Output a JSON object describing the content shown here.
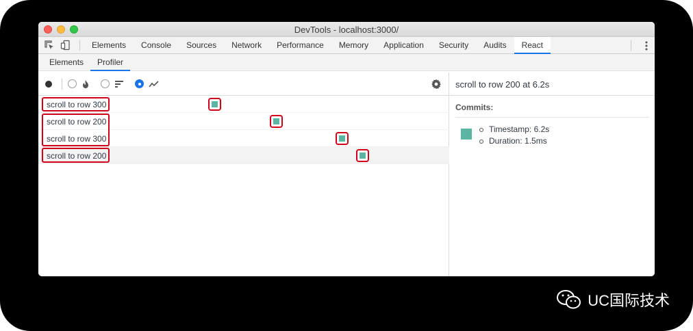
{
  "window": {
    "title": "DevTools - localhost:3000/"
  },
  "main_tabs": [
    {
      "label": "Elements"
    },
    {
      "label": "Console"
    },
    {
      "label": "Sources"
    },
    {
      "label": "Network"
    },
    {
      "label": "Performance"
    },
    {
      "label": "Memory"
    },
    {
      "label": "Application"
    },
    {
      "label": "Security"
    },
    {
      "label": "Audits"
    },
    {
      "label": "React",
      "active": true
    }
  ],
  "sub_tabs": [
    {
      "label": "Elements"
    },
    {
      "label": "Profiler",
      "active": true
    }
  ],
  "interactions": [
    {
      "label": "scroll to row 300",
      "commit_time": 0.42
    },
    {
      "label": "scroll to row 200",
      "commit_time": 0.57
    },
    {
      "label": "scroll to row 300",
      "commit_time": 0.73
    },
    {
      "label": "scroll to row 200",
      "commit_time": 0.78,
      "selected": true
    }
  ],
  "details": {
    "title": "scroll to row 200 at 6.2s",
    "commits_label": "Commits:",
    "timestamp": "Timestamp: 6.2s",
    "duration": "Duration: 1.5ms"
  },
  "watermark": {
    "text": "UC国际技术"
  },
  "colors": {
    "commit": "#5ab5a2",
    "highlight": "#d0021b",
    "accent": "#1a73e8"
  }
}
